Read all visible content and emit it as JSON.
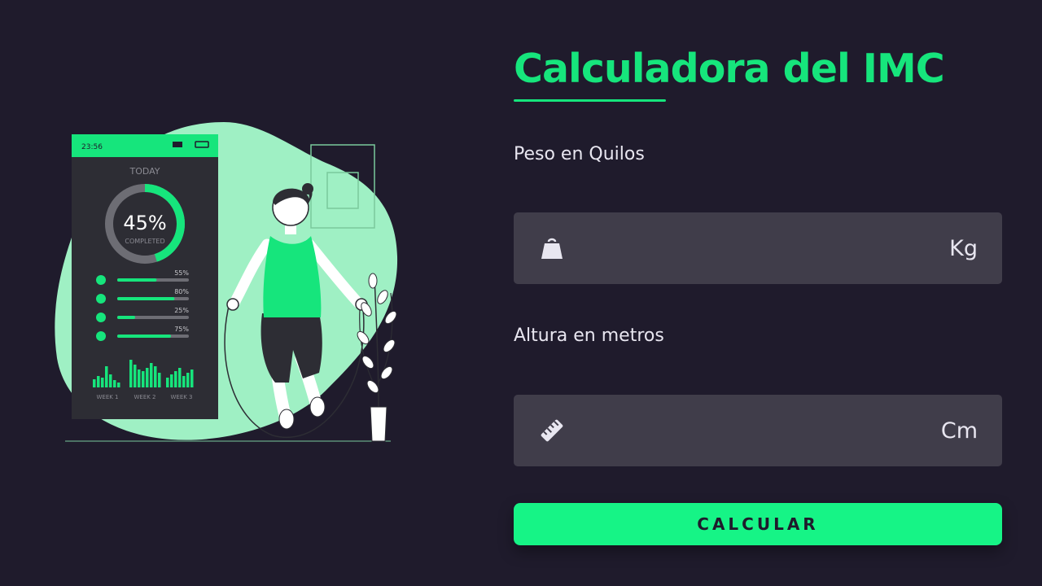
{
  "title": "Calculadora del IMC",
  "colors": {
    "background": "#1f1b2c",
    "accent": "#16e57c",
    "input_background": "#403d4a",
    "text": "#e8e6f0"
  },
  "illustration": {
    "phone": {
      "time": "23:56",
      "heading": "TODAY",
      "progress_percent": "45%",
      "progress_fraction": 0.45,
      "progress_caption": "COMPLETED",
      "stats": [
        {
          "icon": "dumbbell-icon",
          "label": "55%",
          "fraction": 0.55
        },
        {
          "icon": "heart-rate-icon",
          "label": "80%",
          "fraction": 0.8
        },
        {
          "icon": "apple-icon",
          "label": "25%",
          "fraction": 0.25
        },
        {
          "icon": "running-icon",
          "label": "75%",
          "fraction": 0.75
        }
      ],
      "week_labels": [
        "WEEK 1",
        "WEEK 2",
        "WEEK 3"
      ]
    }
  },
  "form": {
    "weight_label": "Peso en Quilos",
    "weight_icon": "weight-icon",
    "weight_value": "",
    "weight_unit": "Kg",
    "height_label": "Altura en metros",
    "height_icon": "ruler-icon",
    "height_value": "",
    "height_unit": "Cm",
    "submit_label": "CALCULAR"
  }
}
